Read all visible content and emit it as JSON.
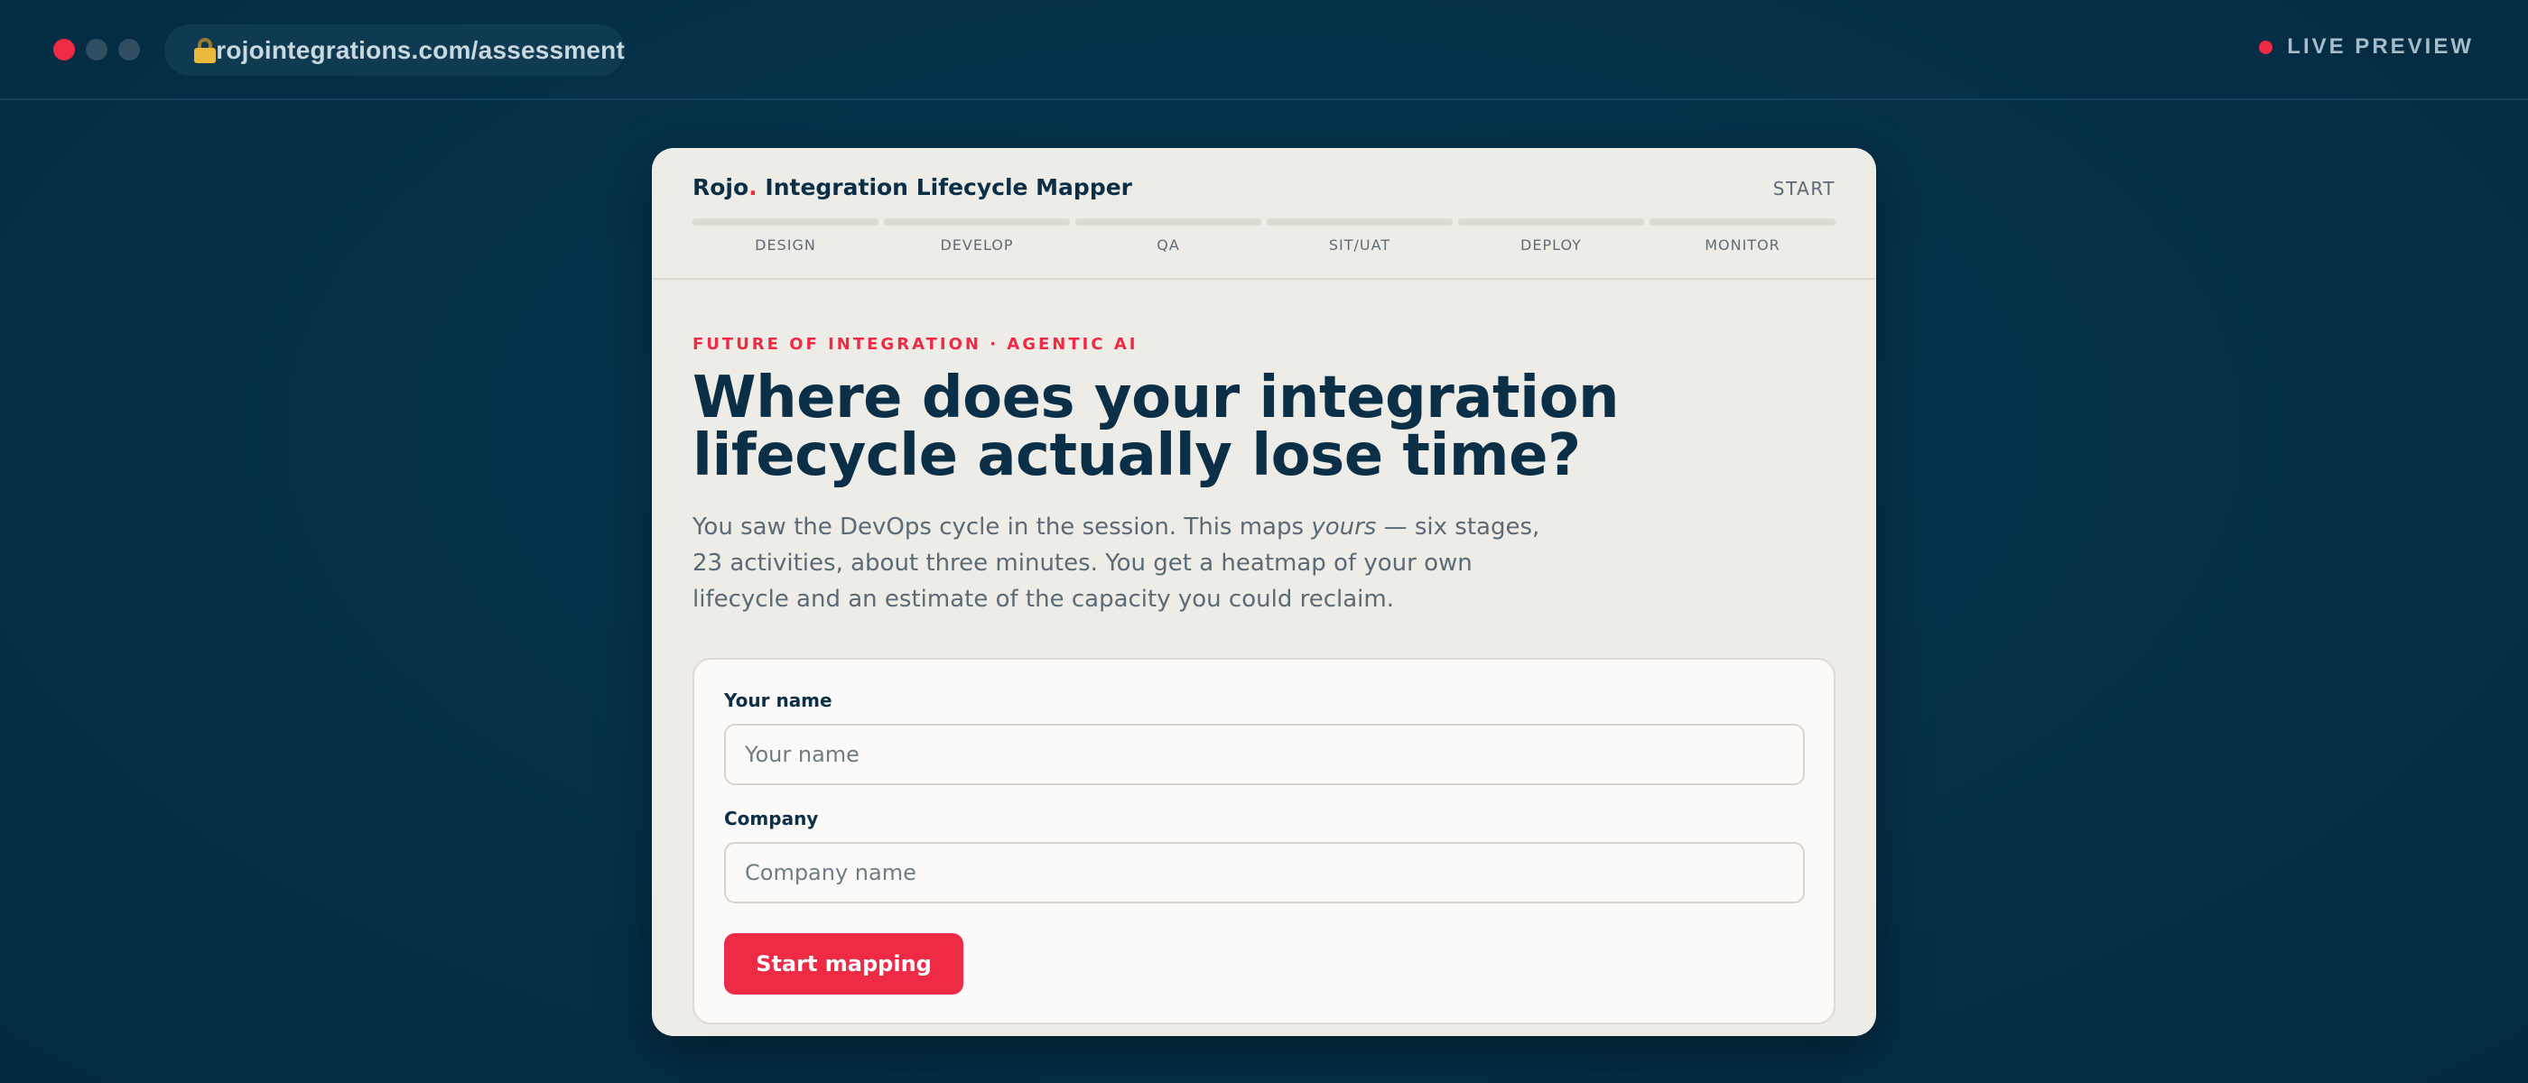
{
  "browser": {
    "url": "rojointegrations.com/assessment",
    "status_label": "LIVE PREVIEW",
    "icons": [
      "close-dot",
      "minimize-dot",
      "maximize-dot",
      "lock-icon",
      "live-indicator-dot"
    ]
  },
  "app": {
    "brand_name": "Rojo",
    "brand_dot": ".",
    "title": "Integration Lifecycle Mapper",
    "step_label": "START",
    "stages": [
      {
        "label": "DESIGN"
      },
      {
        "label": "DEVELOP"
      },
      {
        "label": "QA"
      },
      {
        "label": "SIT/UAT"
      },
      {
        "label": "DEPLOY"
      },
      {
        "label": "MONITOR"
      }
    ]
  },
  "hero": {
    "eyebrow": "FUTURE OF INTEGRATION · AGENTIC AI",
    "headline": "Where does your integration lifecycle actually lose time?",
    "intro_before": "You saw the DevOps cycle in the session. This maps ",
    "intro_emphasis": "yours",
    "intro_after": " — six stages, 23 activities, about three minutes. You get a heatmap of your own lifecycle and an estimate of the capacity you could reclaim."
  },
  "form": {
    "name_label": "Your name",
    "name_placeholder": "Your name",
    "name_value": "",
    "company_label": "Company",
    "company_placeholder": "Company name",
    "company_value": "",
    "submit_label": "Start mapping"
  },
  "colors": {
    "accent": "#ef2a44",
    "navy": "#0b2f47",
    "background": "#053149",
    "card": "#eeece6"
  }
}
